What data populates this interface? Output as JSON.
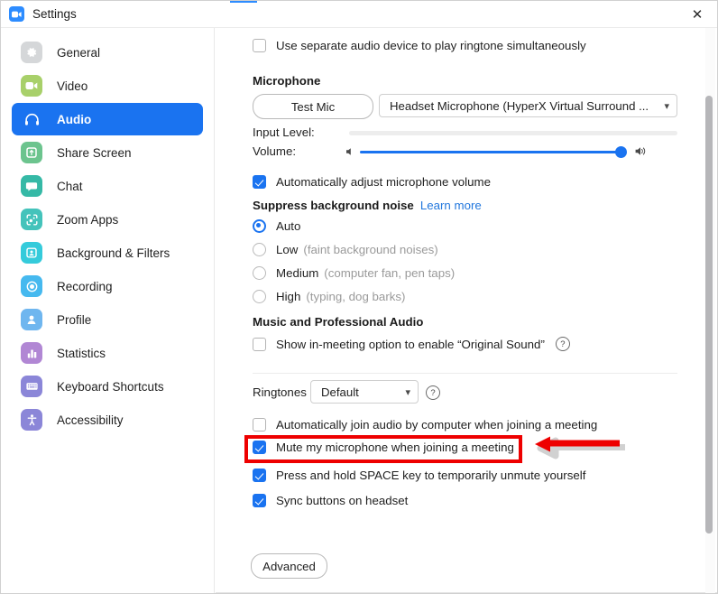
{
  "window": {
    "title": "Settings",
    "app_icon": "zoom-video-icon",
    "close_label": "✕",
    "accent_color": "#2d8cff"
  },
  "sidebar": {
    "items": [
      {
        "label": "General",
        "icon": "gear-icon",
        "color": "#d5d7d9",
        "active": false
      },
      {
        "label": "Video",
        "icon": "video-camera-icon",
        "color": "#a8d06a",
        "active": false
      },
      {
        "label": "Audio",
        "icon": "headphones-icon",
        "color": "#1a73f0",
        "active": true
      },
      {
        "label": "Share Screen",
        "icon": "share-screen-icon",
        "color": "#6cc48e",
        "active": false
      },
      {
        "label": "Chat",
        "icon": "chat-bubble-icon",
        "color": "#35b9a6",
        "active": false
      },
      {
        "label": "Zoom Apps",
        "icon": "zoom-apps-icon",
        "color": "#44c3bb",
        "active": false
      },
      {
        "label": "Background & Filters",
        "icon": "person-frame-icon",
        "color": "#35cbdb",
        "active": false
      },
      {
        "label": "Recording",
        "icon": "record-circle-icon",
        "color": "#46b9ef",
        "active": false
      },
      {
        "label": "Profile",
        "icon": "person-icon",
        "color": "#6fb6ef",
        "active": false
      },
      {
        "label": "Statistics",
        "icon": "bar-chart-icon",
        "color": "#b187d4",
        "active": false
      },
      {
        "label": "Keyboard Shortcuts",
        "icon": "keyboard-icon",
        "color": "#8b86d8",
        "active": false
      },
      {
        "label": "Accessibility",
        "icon": "accessibility-icon",
        "color": "#8b86d8",
        "active": false
      }
    ]
  },
  "main": {
    "separate_ringtone_device": {
      "label": "Use separate audio device to play ringtone simultaneously",
      "checked": false
    },
    "microphone": {
      "heading": "Microphone",
      "test_button": "Test Mic",
      "device": "Headset Microphone (HyperX Virtual Surround ...",
      "input_level_label": "Input Level:",
      "input_level_value": 0,
      "volume_label": "Volume:",
      "volume_value": 96,
      "auto_adjust": {
        "label": "Automatically adjust microphone volume",
        "checked": true
      }
    },
    "suppress_noise": {
      "heading": "Suppress background noise",
      "learn_more": "Learn more",
      "selected": "Auto",
      "options": [
        {
          "label": "Auto",
          "hint": "",
          "selected": true
        },
        {
          "label": "Low",
          "hint": "(faint background noises)",
          "selected": false
        },
        {
          "label": "Medium",
          "hint": "(computer fan, pen taps)",
          "selected": false
        },
        {
          "label": "High",
          "hint": "(typing, dog barks)",
          "selected": false
        }
      ]
    },
    "music_audio": {
      "heading": "Music and Professional Audio",
      "original_sound": {
        "label": "Show in-meeting option to enable “Original Sound”",
        "checked": false,
        "help": "?"
      }
    },
    "ringtones": {
      "label": "Ringtones",
      "value": "Default",
      "help": "?"
    },
    "join_options": [
      {
        "label": "Automatically join audio by computer when joining a meeting",
        "checked": false
      },
      {
        "label": "Mute my microphone when joining a meeting",
        "checked": true
      },
      {
        "label": "Press and hold SPACE key to temporarily unmute yourself",
        "checked": true
      },
      {
        "label": "Sync buttons on headset",
        "checked": true
      }
    ],
    "advanced_button": "Advanced"
  },
  "annotation": {
    "color": "#ee0000",
    "highlight_target": "Mute my microphone when joining a meeting",
    "arrow_direction": "left"
  }
}
